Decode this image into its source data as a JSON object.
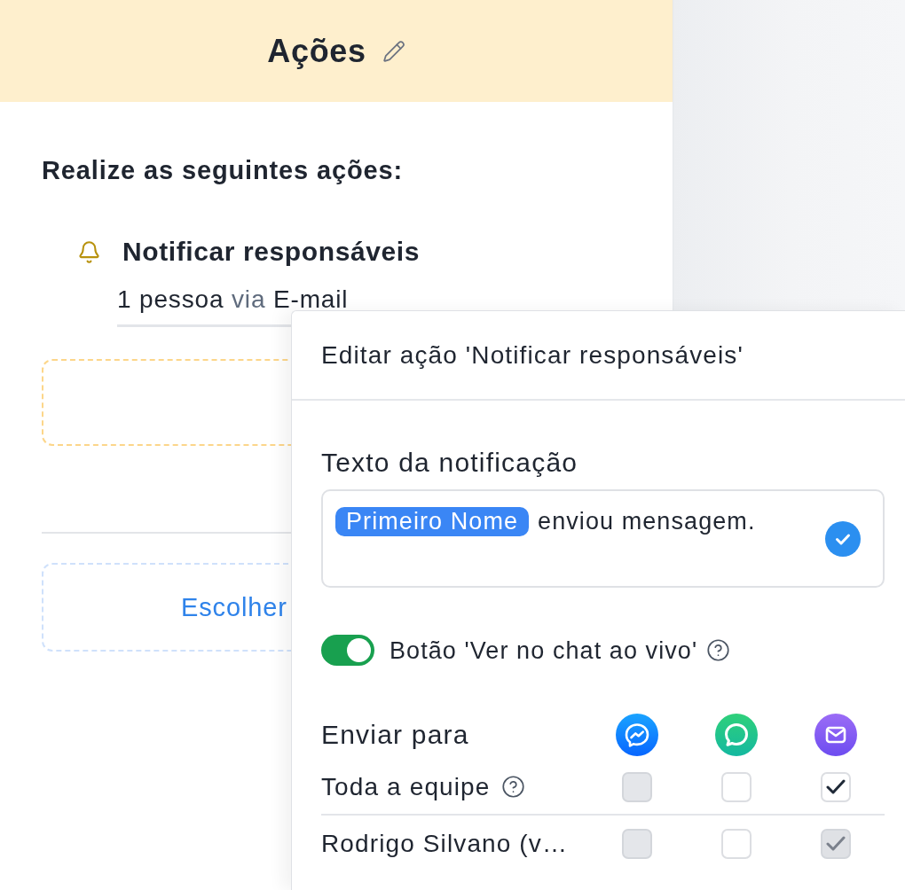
{
  "header": {
    "title": "Ações"
  },
  "intro": "Realize as seguintes ações:",
  "actions": [
    {
      "title": "Notificar responsáveis",
      "summary": {
        "count": "1 pessoa",
        "via": "via",
        "channel": "E-mail"
      }
    }
  ],
  "choose_button": {
    "label": "Escolher"
  },
  "popup": {
    "title": "Editar ação 'Notificar responsáveis'",
    "notification_text": {
      "label": "Texto da notificação",
      "tag": "Primeiro Nome",
      "value": "enviou mensagem."
    },
    "live_chat_toggle": {
      "label": "Botão 'Ver no chat ao vivo'",
      "on": true
    },
    "send_to": {
      "label": "Enviar para",
      "channels": [
        {
          "kind": "messenger"
        },
        {
          "kind": "chat"
        },
        {
          "kind": "email"
        }
      ],
      "rows": [
        {
          "name": "Toda a equipe",
          "help": true,
          "checks": [
            {
              "checked": false,
              "disabled": true
            },
            {
              "checked": false,
              "disabled": false
            },
            {
              "checked": true,
              "disabled": false
            }
          ]
        },
        {
          "name": "Rodrigo Silvano (v…",
          "help": false,
          "checks": [
            {
              "checked": false,
              "disabled": true
            },
            {
              "checked": false,
              "disabled": false
            },
            {
              "checked": true,
              "disabled": true
            }
          ]
        }
      ]
    }
  }
}
